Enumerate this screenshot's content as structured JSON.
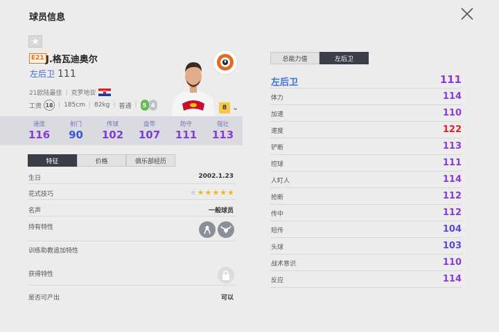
{
  "page": {
    "title": "球员信息"
  },
  "player": {
    "season_badge": "E21",
    "name": "J.格瓦迪奥尔",
    "position": "左后卫",
    "overall": "111",
    "honor": "21欧陆最佳",
    "nation": "克罗地亚",
    "wage_label": "工资",
    "wage": "18",
    "height": "185cm",
    "weight": "82kg",
    "body": "普通",
    "skill_left": "5",
    "skill_right": "4",
    "level": "8"
  },
  "summary_stats": [
    {
      "label": "速度",
      "value": "116",
      "color": "#8a3ad6"
    },
    {
      "label": "射门",
      "value": "90",
      "color": "#3d54d6"
    },
    {
      "label": "传球",
      "value": "102",
      "color": "#7a3fd8"
    },
    {
      "label": "盘带",
      "value": "107",
      "color": "#7a3fd8"
    },
    {
      "label": "防守",
      "value": "111",
      "color": "#8a3ad6"
    },
    {
      "label": "强壮",
      "value": "113",
      "color": "#8a3ad6"
    }
  ],
  "left_tabs": [
    "特征",
    "价格",
    "俱乐部经历"
  ],
  "details": {
    "birthday_label": "生日",
    "birthday": "2002.1.23",
    "skill_moves_label": "花式技巧",
    "skill_moves_stars": 5,
    "reputation_label": "名声",
    "reputation": "一般球员",
    "traits_label": "持有特性",
    "training_traits_label": "训练助教追加特性",
    "acquired_traits_label": "获得特性",
    "tradable_label": "是否可产出",
    "tradable": "可以"
  },
  "right_tabs": [
    "总能力值",
    "左后卫"
  ],
  "position_stats": {
    "head_label": "左后卫",
    "head_value": "111",
    "rows": [
      {
        "label": "体力",
        "value": "114",
        "color": "#8a3ad6"
      },
      {
        "label": "加速",
        "value": "110",
        "color": "#8a3ad6"
      },
      {
        "label": "速度",
        "value": "122",
        "color": "#d6232f"
      },
      {
        "label": "铲断",
        "value": "113",
        "color": "#8a3ad6"
      },
      {
        "label": "控球",
        "value": "111",
        "color": "#8a3ad6"
      },
      {
        "label": "人盯人",
        "value": "114",
        "color": "#8a3ad6"
      },
      {
        "label": "抢断",
        "value": "112",
        "color": "#8a3ad6"
      },
      {
        "label": "传中",
        "value": "112",
        "color": "#8a3ad6"
      },
      {
        "label": "短传",
        "value": "104",
        "color": "#6043d6"
      },
      {
        "label": "头球",
        "value": "103",
        "color": "#6043d6"
      },
      {
        "label": "战术意识",
        "value": "110",
        "color": "#8a3ad6"
      },
      {
        "label": "反应",
        "value": "114",
        "color": "#8a3ad6"
      }
    ]
  }
}
